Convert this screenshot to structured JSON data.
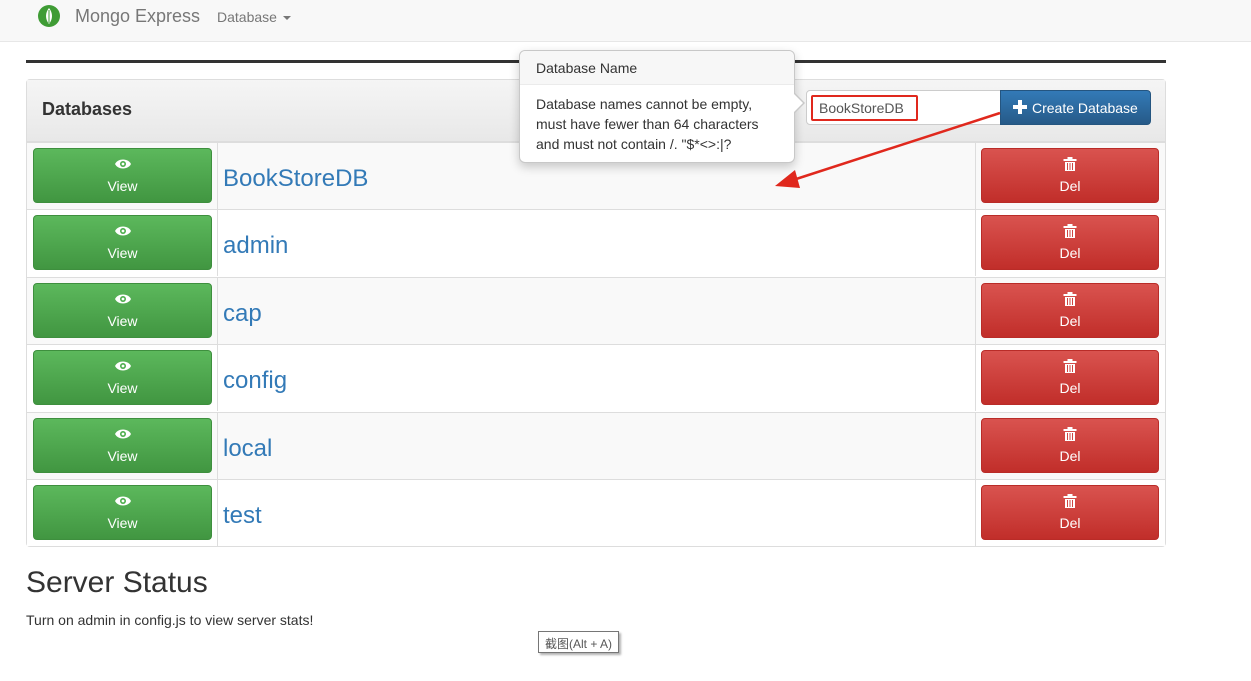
{
  "navbar": {
    "brand": "Mongo Express",
    "database_menu": "Database"
  },
  "panel": {
    "title": "Databases",
    "input_value": "BookStoreDB",
    "create_button": "Create Database"
  },
  "popover": {
    "title": "Database Name",
    "line1": "Database names cannot be empty,",
    "line2": "must have fewer than 64 characters",
    "line3": "and must not contain /. \"$*<>:|?"
  },
  "actions": {
    "view_label": "View",
    "del_label": "Del"
  },
  "databases": [
    {
      "name": "BookStoreDB"
    },
    {
      "name": "admin"
    },
    {
      "name": "cap"
    },
    {
      "name": "config"
    },
    {
      "name": "local"
    },
    {
      "name": "test"
    }
  ],
  "server_status": {
    "heading": "Server Status",
    "note": "Turn on admin in config.js to view server stats!"
  },
  "screenshot_tooltip": "截图(Alt + A)",
  "colors": {
    "primary": "#337ab7",
    "success": "#5cb85c",
    "danger": "#d9534f",
    "annotation_red": "#e0281d",
    "brand_green": "#3f9c35"
  }
}
